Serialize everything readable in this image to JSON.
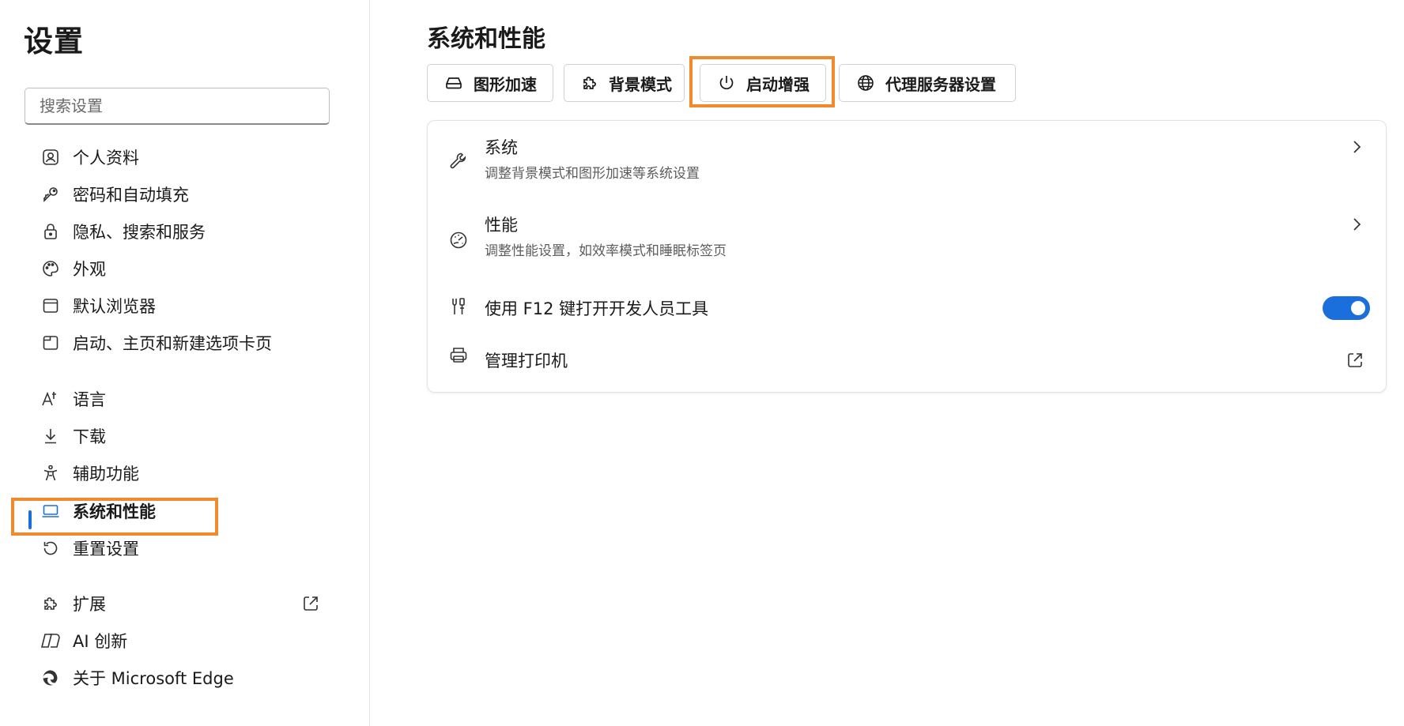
{
  "sidebar": {
    "title": "设置",
    "search_placeholder": "搜索设置",
    "items": [
      {
        "label": "个人资料"
      },
      {
        "label": "密码和自动填充"
      },
      {
        "label": "隐私、搜索和服务"
      },
      {
        "label": "外观"
      },
      {
        "label": "默认浏览器"
      },
      {
        "label": "启动、主页和新建选项卡页"
      },
      {
        "label": "语言"
      },
      {
        "label": "下载"
      },
      {
        "label": "辅助功能"
      },
      {
        "label": "系统和性能"
      },
      {
        "label": "重置设置"
      },
      {
        "label": "扩展"
      },
      {
        "label": "AI 创新"
      },
      {
        "label": "关于 Microsoft Edge"
      }
    ]
  },
  "main": {
    "title": "系统和性能",
    "tabs": [
      {
        "label": "图形加速"
      },
      {
        "label": "背景模式"
      },
      {
        "label": "启动增强"
      },
      {
        "label": "代理服务器设置"
      }
    ],
    "rows": [
      {
        "title": "系统",
        "desc": "调整背景模式和图形加速等系统设置"
      },
      {
        "title": "性能",
        "desc": "调整性能设置，如效率模式和睡眠标签页"
      },
      {
        "title": "使用 F12 键打开开发人员工具"
      },
      {
        "title": "管理打印机"
      }
    ]
  },
  "colors": {
    "accent": "#1a6fdc",
    "highlight": "#f28a2c"
  }
}
